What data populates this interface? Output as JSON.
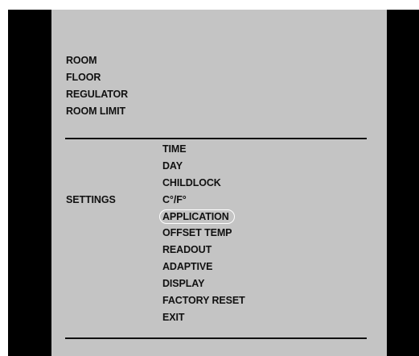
{
  "main_menu": {
    "items": [
      {
        "label": "ROOM"
      },
      {
        "label": "FLOOR"
      },
      {
        "label": "REGULATOR"
      },
      {
        "label": "ROOM LIMIT"
      }
    ]
  },
  "settings": {
    "label": "SETTINGS",
    "items": [
      {
        "label": "TIME"
      },
      {
        "label": "DAY"
      },
      {
        "label": "CHILDLOCK"
      },
      {
        "label": "C°/F°"
      },
      {
        "label": "APPLICATION",
        "selected": true
      },
      {
        "label": "OFFSET TEMP"
      },
      {
        "label": "READOUT"
      },
      {
        "label": "ADAPTIVE"
      },
      {
        "label": "DISPLAY"
      },
      {
        "label": "FACTORY RESET"
      },
      {
        "label": "EXIT"
      }
    ]
  },
  "colors": {
    "panel": "#c4c4c4",
    "bezel": "#000000",
    "text": "#111111",
    "selection_outline": "#ffffff"
  }
}
